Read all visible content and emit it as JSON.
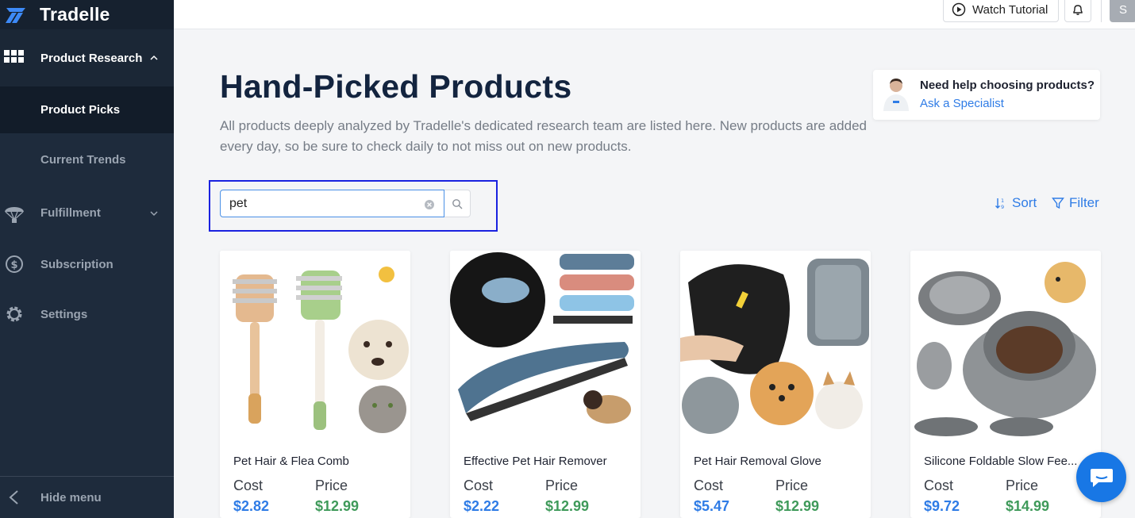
{
  "brand": {
    "name": "Tradelle"
  },
  "sidebar": {
    "items": [
      {
        "label": "Product Research",
        "icon": "grid-icon",
        "expanded": true
      },
      {
        "label": "Product Picks",
        "active": true
      },
      {
        "label": "Current Trends"
      },
      {
        "label": "Fulfillment",
        "icon": "parachute-icon"
      },
      {
        "label": "Subscription",
        "icon": "dollar-cycle-icon"
      },
      {
        "label": "Settings",
        "icon": "gear-icon"
      }
    ],
    "hide_menu": "Hide menu"
  },
  "topbar": {
    "tutorial_label": "Watch Tutorial",
    "avatar_initial": "S"
  },
  "main": {
    "title": "Hand-Picked Products",
    "subtitle": "All products deeply analyzed by Tradelle's dedicated research team are listed here. New products are added every day, so be sure to check daily to not miss out on new products.",
    "help": {
      "question": "Need help choosing products?",
      "link": "Ask a Specialist"
    },
    "search": {
      "value": "pet"
    },
    "sort_label": "Sort",
    "filter_label": "Filter"
  },
  "products": [
    {
      "name": "Pet Hair & Flea Comb",
      "cost_label": "Cost",
      "price_label": "Price",
      "cost": "$2.82",
      "price": "$12.99"
    },
    {
      "name": "Effective Pet Hair Remover",
      "cost_label": "Cost",
      "price_label": "Price",
      "cost": "$2.22",
      "price": "$12.99"
    },
    {
      "name": "Pet Hair Removal Glove",
      "cost_label": "Cost",
      "price_label": "Price",
      "cost": "$5.47",
      "price": "$12.99"
    },
    {
      "name": "Silicone Foldable Slow Fee...",
      "cost_label": "Cost",
      "price_label": "Price",
      "cost": "$9.72",
      "price": "$14.99"
    }
  ],
  "colors": {
    "sidebar": "#1e2b3c",
    "accent": "#2f7ce6",
    "price_green": "#3f9a5a",
    "title": "#13243f"
  }
}
